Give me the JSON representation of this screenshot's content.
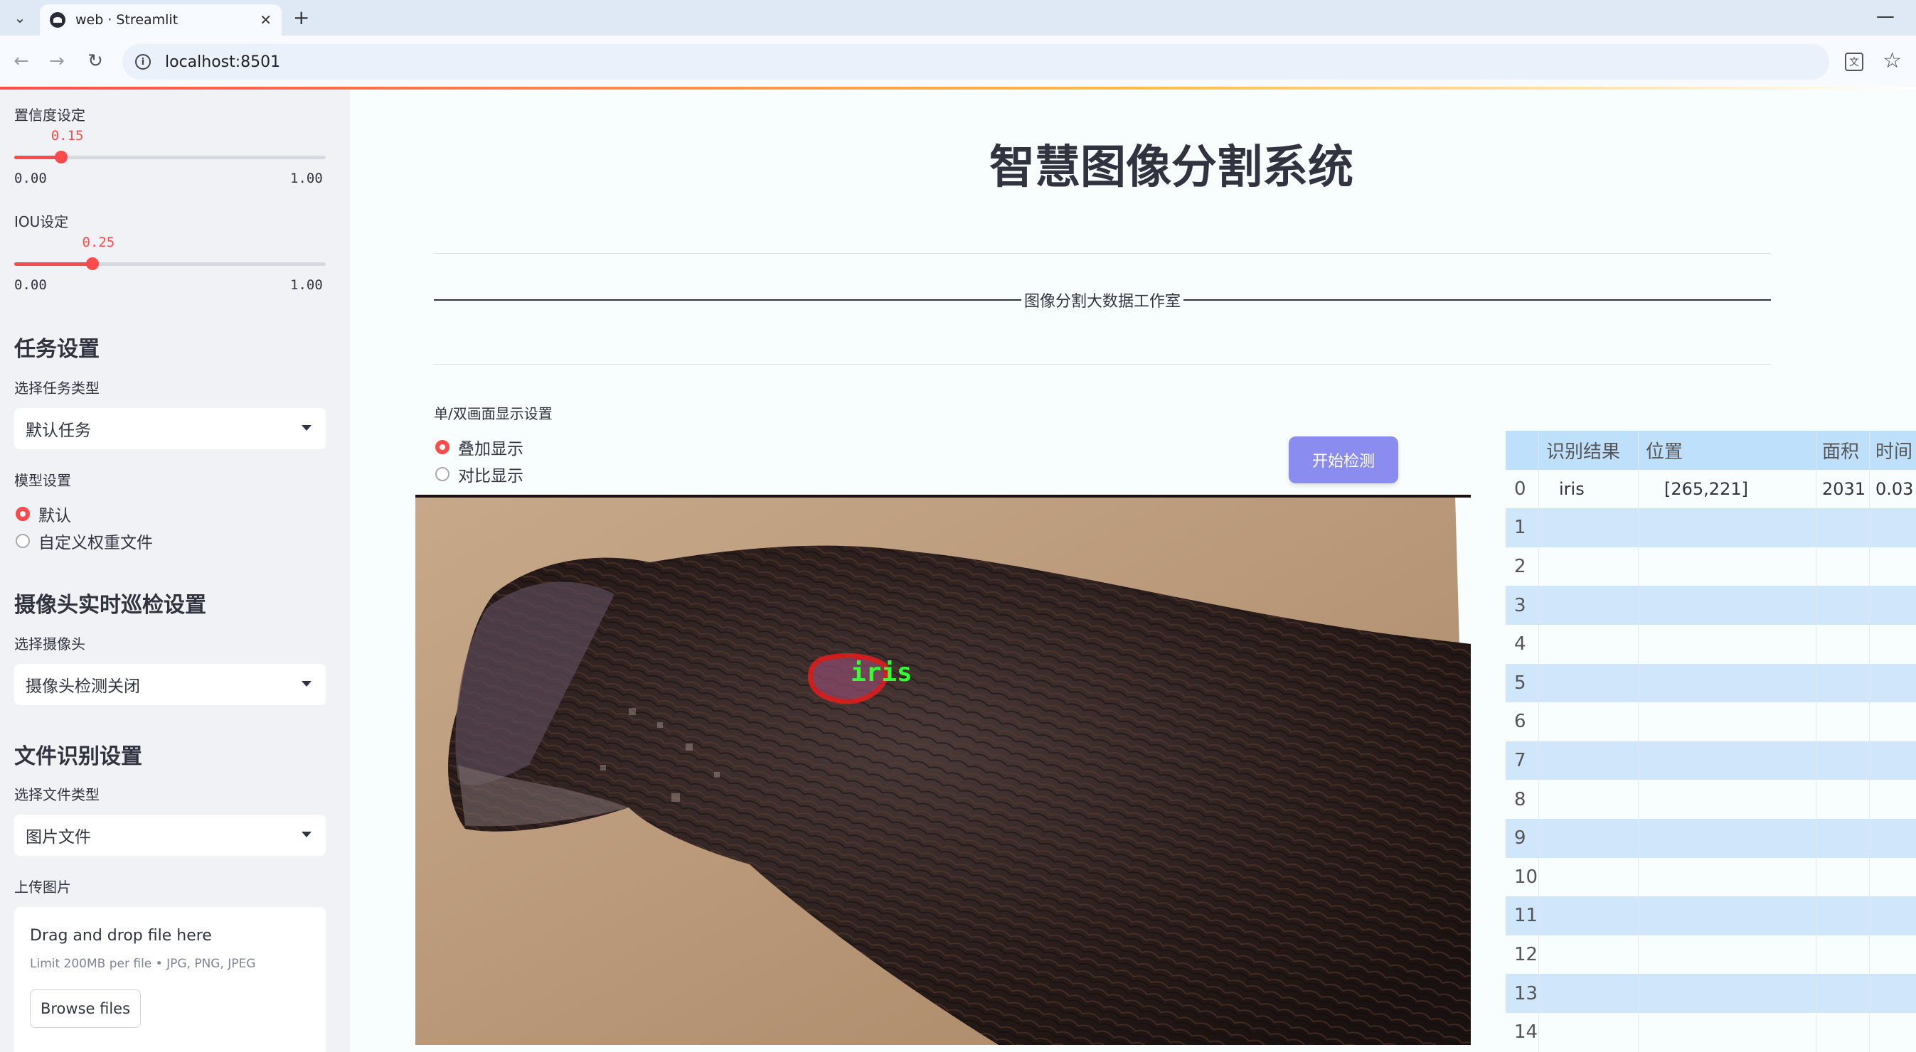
{
  "browser": {
    "tab_title": "web · Streamlit",
    "url": "localhost:8501"
  },
  "sidebar": {
    "confidence": {
      "label": "置信度设定",
      "value": "0.15",
      "value_num": 0.15,
      "min": "0.00",
      "max": "1.00"
    },
    "iou": {
      "label": "IOU设定",
      "value": "0.25",
      "value_num": 0.25,
      "min": "0.00",
      "max": "1.00"
    },
    "task_heading": "任务设置",
    "task_type_label": "选择任务类型",
    "task_type_value": "默认任务",
    "model_label": "模型设置",
    "model_options": [
      "默认",
      "自定义权重文件"
    ],
    "model_selected": "默认",
    "camera_heading": "摄像头实时巡检设置",
    "camera_label": "选择摄像头",
    "camera_value": "摄像头检测关闭",
    "file_heading": "文件识别设置",
    "file_type_label": "选择文件类型",
    "file_type_value": "图片文件",
    "upload_label": "上传图片",
    "uploader": {
      "drop_text": "Drag and drop file here",
      "limit_text": "Limit 200MB per file • JPG, PNG, JPEG",
      "browse_label": "Browse files"
    }
  },
  "main": {
    "title": "智慧图像分割系统",
    "banner_text": "图像分割大数据工作室",
    "display_label": "单/双画面显示设置",
    "display_options": [
      "叠加显示",
      "对比显示"
    ],
    "display_selected": "叠加显示",
    "start_button": "开始检测",
    "detection_label": "iris"
  },
  "results_table": {
    "columns": [
      "识别结果",
      "位置",
      "面积",
      "时间"
    ],
    "rows": [
      {
        "index": "0",
        "label": "iris",
        "position": "[265,221]",
        "area": "2031",
        "time": "0.03"
      },
      {
        "index": "1"
      },
      {
        "index": "2"
      },
      {
        "index": "3"
      },
      {
        "index": "4"
      },
      {
        "index": "5"
      },
      {
        "index": "6"
      },
      {
        "index": "7"
      },
      {
        "index": "8"
      },
      {
        "index": "9"
      },
      {
        "index": "10"
      },
      {
        "index": "11"
      },
      {
        "index": "12"
      },
      {
        "index": "13"
      },
      {
        "index": "14"
      }
    ]
  },
  "colors": {
    "accent": "#ff4b4b",
    "button": "#8b8cf0",
    "sidebar_bg": "#f0f2f6",
    "table_stripe": "#cfe6fb",
    "mask_outline": "#ff1a1a",
    "label_green": "#33ff33"
  }
}
